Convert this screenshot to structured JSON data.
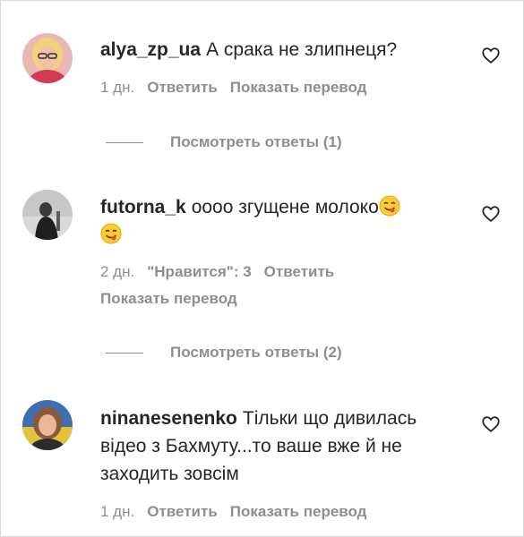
{
  "comments": [
    {
      "username": "alya_zp_ua",
      "text": "А срака не злипнеця?",
      "time": "1 дн.",
      "reply": "Ответить",
      "translate": "Показать перевод",
      "view_replies": "Посмотреть ответы (1)"
    },
    {
      "username": "futorna_k",
      "text": "оооо згущене молоко",
      "emoji": "yum-face-emoji",
      "time": "2 дн.",
      "likes": "\"Нравится\": 3",
      "reply": "Ответить",
      "translate": "Показать перевод",
      "view_replies": "Посмотреть ответы (2)"
    },
    {
      "username": "ninanesenenko",
      "text": "Тільки що дивилась відео з Бахмуту...то ваше вже й не заходить зовсім",
      "time": "1 дн.",
      "reply": "Ответить",
      "translate": "Показать перевод"
    }
  ],
  "icons": {
    "like": "heart-outline-icon"
  },
  "colors": {
    "text": "#262626",
    "secondary": "#8e8e8e",
    "background": "#ffffff"
  }
}
